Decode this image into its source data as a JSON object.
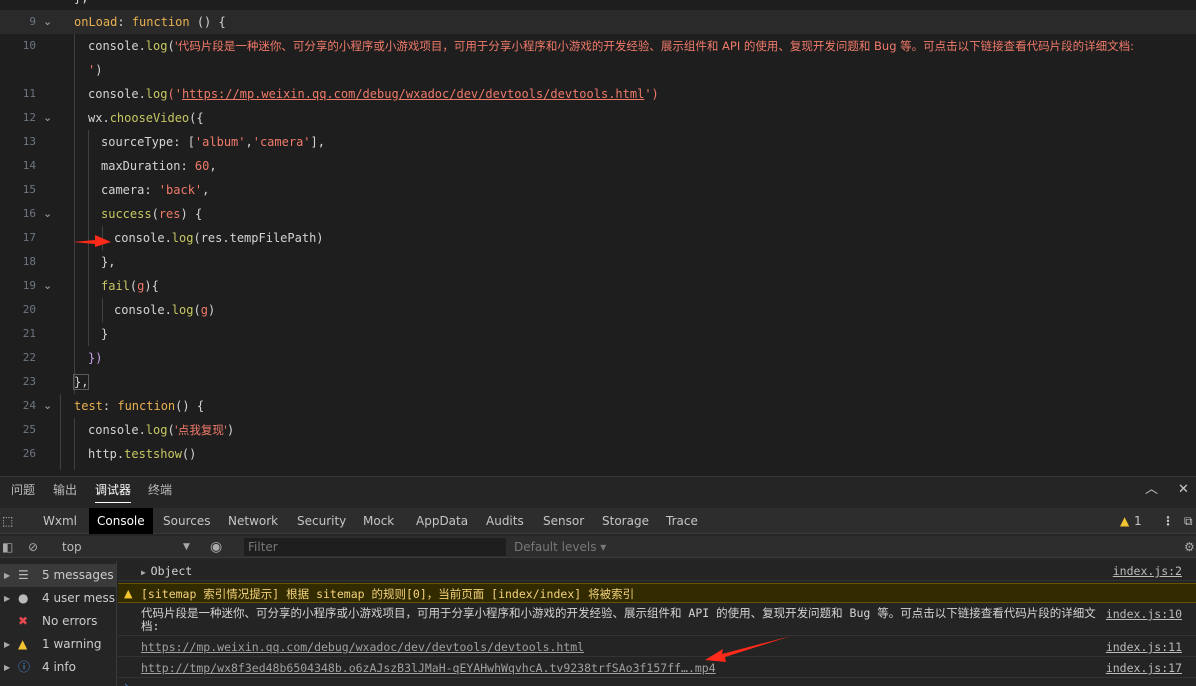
{
  "editor": {
    "lines": [
      {
        "num": "",
        "fold": ""
      },
      {
        "num": "9",
        "fold": "⌄"
      },
      {
        "num": "10",
        "fold": ""
      },
      {
        "num": "",
        "fold": ""
      },
      {
        "num": "11",
        "fold": ""
      },
      {
        "num": "12",
        "fold": "⌄"
      },
      {
        "num": "13",
        "fold": ""
      },
      {
        "num": "14",
        "fold": ""
      },
      {
        "num": "15",
        "fold": ""
      },
      {
        "num": "16",
        "fold": "⌄"
      },
      {
        "num": "17",
        "fold": ""
      },
      {
        "num": "18",
        "fold": ""
      },
      {
        "num": "19",
        "fold": "⌄"
      },
      {
        "num": "20",
        "fold": ""
      },
      {
        "num": "21",
        "fold": ""
      },
      {
        "num": "22",
        "fold": ""
      },
      {
        "num": "23",
        "fold": ""
      },
      {
        "num": "24",
        "fold": "⌄"
      },
      {
        "num": "25",
        "fold": ""
      },
      {
        "num": "26",
        "fold": ""
      }
    ],
    "code": {
      "l0": "},",
      "l9_key": "onLoad",
      "l9_kw": "function",
      "l9_rest": " () {",
      "l10_obj": "console.",
      "l10_fn": "log",
      "l10_str": "'代码片段是一种迷你、可分享的小程序或小游戏项目，可用于分享小程序和小游戏的开发经验、展示组件和 API 的使用、复现开发问题和 Bug 等。可点击以下链接查看代码片段的详细文档:",
      "l10b_str": "'",
      "l10b_rest": ")",
      "l11_obj": "console.",
      "l11_fn": "log",
      "l11_open": "('",
      "l11_url": "https://mp.weixin.qq.com/debug/wxadoc/dev/devtools/devtools.html",
      "l11_close": "')",
      "l12_obj": "wx.",
      "l12_fn": "chooseVideo",
      "l12_rest": "({",
      "l13_key": "sourceType: [",
      "l13_s1": "'album'",
      "l13_c": ",",
      "l13_s2": "'camera'",
      "l13_end": "],",
      "l14_key": "maxDuration: ",
      "l14_num": "60",
      "l14_end": ",",
      "l15_key": "camera: ",
      "l15_str": "'back'",
      "l15_end": ",",
      "l16_fn": "success",
      "l16_open": "(",
      "l16_param": "res",
      "l16_close": ") {",
      "l17_obj": "console.",
      "l17_fn": "log",
      "l17_rest": "(res.tempFilePath)",
      "l18": "},",
      "l19_fn": "fail",
      "l19_open": "(",
      "l19_param": "g",
      "l19_close": "){",
      "l20_obj": "console.",
      "l20_fn": "log",
      "l20_open": "(",
      "l20_param": "g",
      "l20_close": ")",
      "l21": "}",
      "l22": "})",
      "l23": "},",
      "l24_key": "test",
      "l24_kw": "function",
      "l24_rest": "() {",
      "l25_obj": "console.",
      "l25_fn": "log",
      "l25_open": "(",
      "l25_str": "'点我复现'",
      "l25_close": ")",
      "l26_obj": "http.",
      "l26_fn": "testshow",
      "l26_rest": "()"
    }
  },
  "panel": {
    "tabs": [
      "问题",
      "输出",
      "调试器",
      "终端"
    ],
    "active_tab": "调试器"
  },
  "devtools": {
    "tabs": [
      "Wxml",
      "Console",
      "Sources",
      "Network",
      "Security",
      "Mock",
      "AppData",
      "Audits",
      "Sensor",
      "Storage",
      "Trace"
    ],
    "active_tab": "Console",
    "warning_count": "1"
  },
  "filterbar": {
    "context": "top",
    "filter_placeholder": "Filter",
    "levels": "Default levels ▾"
  },
  "sidebar": {
    "items": [
      {
        "label": "5 messages",
        "icon": "list-icon"
      },
      {
        "label": "4 user mess...",
        "icon": "user-icon"
      },
      {
        "label": "No errors",
        "icon": "error-icon"
      },
      {
        "label": "1 warning",
        "icon": "warning-icon"
      },
      {
        "label": "4 info",
        "icon": "info-icon"
      }
    ]
  },
  "console": {
    "rows": [
      {
        "text": "Object",
        "source": "index.js:2"
      },
      {
        "text": "[sitemap 索引情况提示] 根据 sitemap 的规则[0]，当前页面 [index/index] 将被索引",
        "source": ""
      },
      {
        "text": "代码片段是一种迷你、可分享的小程序或小游戏项目，可用于分享小程序和小游戏的开发经验、展示组件和 API 的使用、复现开发问题和 Bug 等。可点击以下链接查看代码片段的详细文档:",
        "source": "index.js:10"
      },
      {
        "text": "https://mp.weixin.qq.com/debug/wxadoc/dev/devtools/devtools.html",
        "source": "index.js:11"
      },
      {
        "text": "http://tmp/wx8f3ed48b6504348b.o6zAJszB3lJMaH-qEYAHwhWqvhcA.tv9238trfSAo3f157ff….mp4",
        "source": "index.js:17"
      }
    ]
  },
  "colors": {
    "annotation_arrow": "#ff2a1a",
    "warning": "#f4c430"
  }
}
